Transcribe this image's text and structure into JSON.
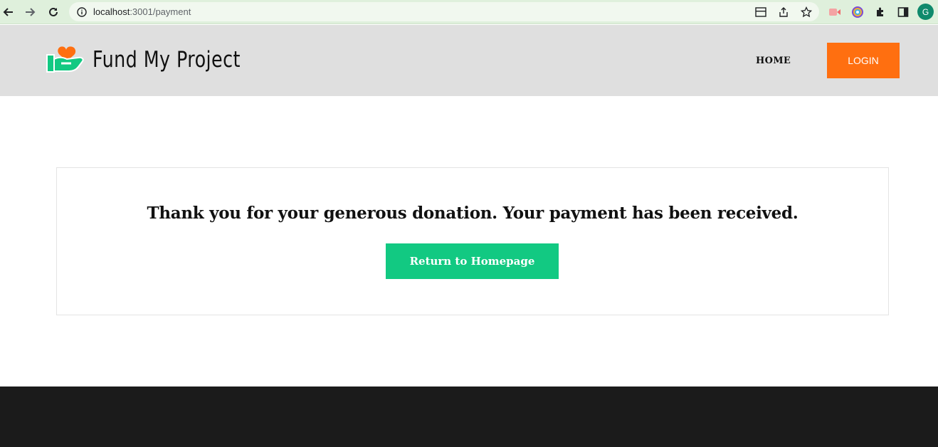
{
  "browser": {
    "url_host": "localhost",
    "url_rest": ":3001/payment",
    "profile_initial": "G"
  },
  "header": {
    "brand": "Fund My Project",
    "nav_home": "HOME",
    "login_label": "LOGIN"
  },
  "main": {
    "message": "Thank you for your generous donation. Your payment has been received.",
    "return_label": "Return to Homepage"
  },
  "colors": {
    "accent_orange": "#ff6f10",
    "accent_green": "#12c982",
    "header_bg": "#dfdfdf",
    "footer_bg": "#1b1b1b"
  }
}
